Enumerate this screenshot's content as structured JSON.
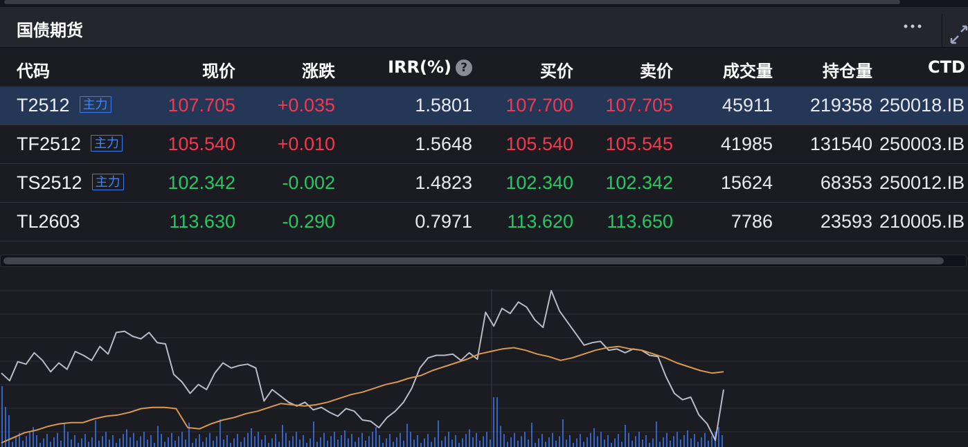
{
  "panel": {
    "title": "国债期货",
    "more_icon": "more-horizontal-icon",
    "expand_icon": "expand-icon"
  },
  "columns": {
    "code": "代码",
    "price": "现价",
    "change": "涨跌",
    "irr": "IRR(%)",
    "irr_help": "?",
    "bid": "买价",
    "ask": "卖价",
    "volume": "成交量",
    "open_interest": "持仓量",
    "ctd": "CTD"
  },
  "rows": [
    {
      "code": "T2512",
      "badge": "主力",
      "price": "107.705",
      "change": "+0.035",
      "irr": "1.5801",
      "bid": "107.700",
      "ask": "107.705",
      "volume": "45911",
      "open_interest": "219358",
      "ctd": "250018.IB",
      "direction": "up",
      "selected": true
    },
    {
      "code": "TF2512",
      "badge": "主力",
      "price": "105.540",
      "change": "+0.010",
      "irr": "1.5648",
      "bid": "105.540",
      "ask": "105.545",
      "volume": "41985",
      "open_interest": "131540",
      "ctd": "250003.IB",
      "direction": "up",
      "selected": false
    },
    {
      "code": "TS2512",
      "badge": "主力",
      "price": "102.342",
      "change": "-0.002",
      "irr": "1.4823",
      "bid": "102.340",
      "ask": "102.342",
      "volume": "15624",
      "open_interest": "68353",
      "ctd": "250012.IB",
      "direction": "down",
      "selected": false
    },
    {
      "code": "TL2603",
      "badge": "",
      "price": "113.630",
      "change": "-0.290",
      "irr": "0.7971",
      "bid": "113.620",
      "ask": "113.650",
      "volume": "7786",
      "open_interest": "23593",
      "ctd": "210005.IB",
      "direction": "down",
      "selected": false
    }
  ],
  "colors": {
    "up": "#f5384f",
    "down": "#26c764",
    "price_line": "#b9bcc8",
    "avg_line": "#d99a4e",
    "volume_bar": "#3b6fe0",
    "selected_row": "#253757"
  },
  "chart_data": {
    "type": "line",
    "series": [
      {
        "values": [
          105.5,
          104.9,
          106.4,
          106.2,
          107.1,
          106.5,
          105.6,
          106.3,
          105.8,
          107.2,
          106.9,
          106.5,
          107.6,
          107.0,
          108.7,
          108.8,
          108.4,
          108.2,
          108.7,
          107.9,
          107.8,
          105.4,
          104.8,
          103.9,
          104.6,
          104.2,
          105.5,
          106.3,
          105.9,
          106.1,
          106.2,
          105.9,
          103.3,
          104.2,
          103.7,
          103.2,
          102.9,
          103.2,
          102.6,
          102.8,
          102.4,
          102.1,
          102.7,
          102.5,
          101.8,
          101.7,
          101.2,
          102.0,
          102.5,
          103.2,
          104.3,
          105.9,
          106.7,
          106.9,
          106.9,
          107.0,
          106.5,
          107.1,
          106.6,
          110.3,
          109.2,
          110.6,
          110.2,
          111.1,
          110.7,
          109.7,
          109.1,
          112.0,
          110.4,
          109.5,
          108.6,
          107.7,
          107.9,
          108.0,
          107.3,
          107.4,
          107.1,
          107.4,
          107.3,
          106.9,
          106.8,
          105.2,
          103.9,
          103.4,
          103.6,
          102.2,
          101.5,
          100.2,
          104.2
        ]
      },
      {
        "values": [
          100.0,
          100.4,
          100.8,
          101.0,
          101.3,
          101.5,
          101.6,
          101.6,
          101.9,
          102.1,
          102.2,
          102.4,
          102.7,
          102.8,
          102.8,
          102.7,
          101.2,
          101.1,
          101.5,
          101.8,
          102.0,
          102.3,
          102.5,
          102.8,
          103.1,
          103.0,
          102.9,
          103.0,
          103.2,
          103.5,
          103.8,
          104.0,
          104.3,
          104.6,
          104.8,
          105.1,
          105.3,
          105.7,
          106.0,
          106.3,
          106.6,
          107.0,
          107.2,
          107.4,
          107.5,
          107.3,
          107.0,
          106.8,
          106.5,
          106.7,
          107.0,
          107.3,
          107.5,
          107.6,
          107.4,
          107.3,
          107.0,
          106.7,
          106.3,
          106.0,
          105.7,
          105.5,
          105.6
        ]
      }
    ]
  }
}
